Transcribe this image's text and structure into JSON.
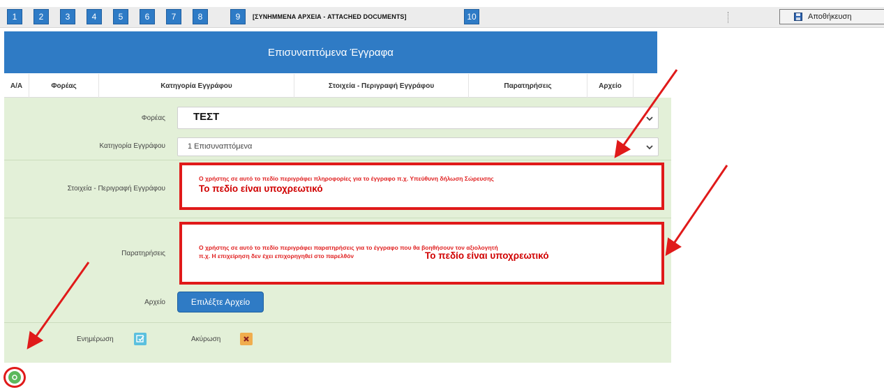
{
  "steps": [
    "1",
    "2",
    "3",
    "4",
    "5",
    "6",
    "7",
    "8",
    "9",
    "10"
  ],
  "step9_label": "[ΣΥΝΗΜΜΕΝΑ ΑΡΧΕΙΑ - ATTACHED DOCUMENTS]",
  "save_label": "Αποθήκευση",
  "panel_title": "Επισυναπτόμενα Έγγραφα",
  "columns": [
    "Α/Α",
    "Φορέας",
    "Κατηγορία Εγγράφου",
    "Στοιχεία - Περιγραφή Εγγράφου",
    "Παρατηρήσεις",
    "Αρχείο"
  ],
  "form": {
    "foreas_label": "Φορέας",
    "foreas_value": "ΤΕΣΤ",
    "category_label": "Κατηγορία Εγγράφου",
    "category_value": "1 Επισυναπτόμενα",
    "description_label": "Στοιχεία - Περιγραφή Εγγράφου",
    "description_note": "Ο χρήστης σε αυτό το πεδίο περιγράφει πληροφορίες για το έγγραφο π.χ. Υπεύθυνη δήλωση Σώρευσης",
    "description_required": "Το πεδίο είναι υποχρεωτικό",
    "remarks_label": "Παρατηρήσεις",
    "remarks_note_line1": "Ο χρήστης σε αυτό το πεδίο περιγράφει παρατηρήσεις για το έγγραφο που θα βοηθήσουν τον αξιολογητή",
    "remarks_note_line2": "π.χ. Η επιχείρηση δεν έχει επιχορηγηθεί στο παρελθόν",
    "remarks_required": "Το πεδίο είναι υποχρεωτικό",
    "file_label": "Αρχείο",
    "file_button": "Επιλέξτε Αρχείο",
    "update_label": "Ενημέρωση",
    "cancel_label": "Ακύρωση"
  },
  "icons": {
    "save": "floppy-disk-icon",
    "update": "edit-check-icon",
    "cancel": "close-x-icon",
    "add": "add-circle-icon"
  },
  "colors": {
    "primary": "#2f7bc5",
    "form_bg": "#e3f0d8",
    "annotation_red": "#e01a1a",
    "update_icon": "#5bc0de",
    "cancel_icon": "#f0ad4e",
    "add_icon": "#5cb85c"
  }
}
